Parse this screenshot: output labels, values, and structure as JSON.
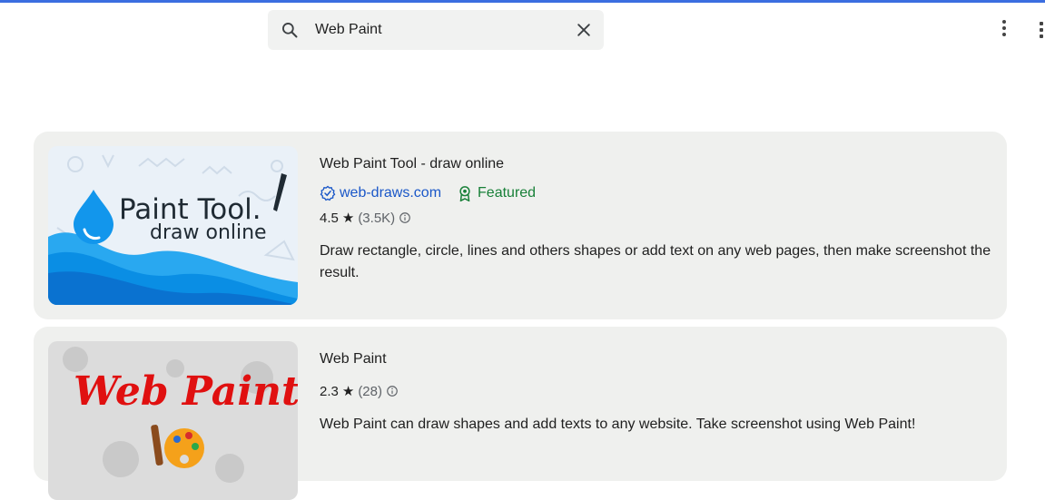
{
  "search": {
    "value": "Web Paint"
  },
  "results": [
    {
      "title": "Web Paint Tool - draw online",
      "site": "web-draws.com",
      "badge": "Featured",
      "rating": "4.5",
      "rating_count": "(3.5K)",
      "description": "Draw rectangle, circle, lines and others shapes or add text on any web pages, then make screenshot the result.",
      "thumb_line1": "Paint Tool.",
      "thumb_line2": "draw online"
    },
    {
      "title": "Web Paint",
      "rating": "2.3",
      "rating_count": "(28)",
      "description": "Web Paint can draw shapes and add texts to any website. Take screenshot using Web Paint!",
      "thumb_title": "Web Paint"
    }
  ],
  "colors": {
    "accent": "#1a57c8",
    "featured": "#188038",
    "card_bg": "#eff0ee"
  }
}
